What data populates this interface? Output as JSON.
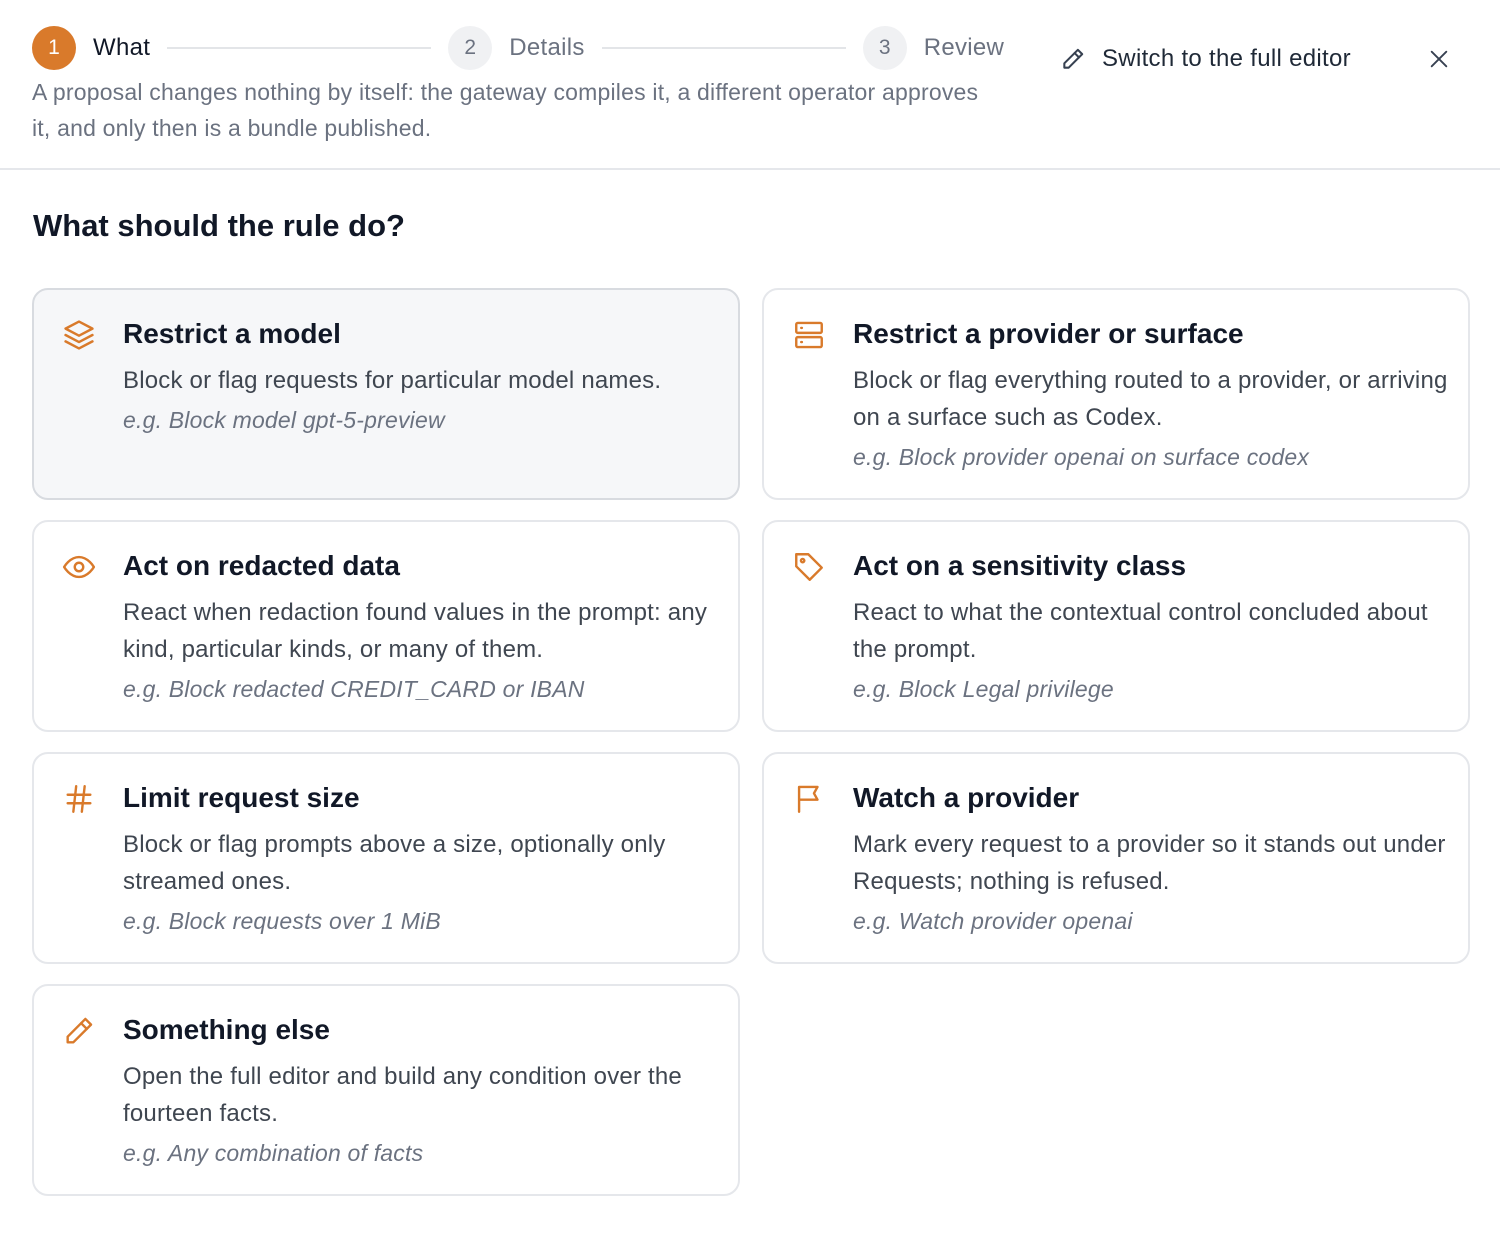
{
  "steps": [
    {
      "number": "1",
      "label": "What"
    },
    {
      "number": "2",
      "label": "Details"
    },
    {
      "number": "3",
      "label": "Review"
    }
  ],
  "header": {
    "switch_label": "Switch to the full editor",
    "subtitle": "A proposal changes nothing by itself: the gateway compiles it, a different operator approves it, and only then is a bundle published."
  },
  "question": "What should the rule do?",
  "accent_color": "#d97a2b",
  "options": [
    {
      "title": "Restrict a model",
      "description": "Block or flag requests for particular model names.",
      "example": "e.g. Block model gpt-5-preview",
      "icon": "layers-icon"
    },
    {
      "title": "Restrict a provider or surface",
      "description": "Block or flag everything routed to a provider, or arriving on a surface such as Codex.",
      "example": "e.g. Block provider openai on surface codex",
      "icon": "server-icon"
    },
    {
      "title": "Act on redacted data",
      "description": "React when redaction found values in the prompt: any kind, particular kinds, or many of them.",
      "example": "e.g. Block redacted CREDIT_CARD or IBAN",
      "icon": "eye-icon"
    },
    {
      "title": "Act on a sensitivity class",
      "description": "React to what the contextual control concluded about the prompt.",
      "example": "e.g. Block Legal privilege",
      "icon": "tag-icon"
    },
    {
      "title": "Limit request size",
      "description": "Block or flag prompts above a size, optionally only streamed ones.",
      "example": "e.g. Block requests over 1 MiB",
      "icon": "hash-icon"
    },
    {
      "title": "Watch a provider",
      "description": "Mark every request to a provider so it stands out under Requests; nothing is refused.",
      "example": "e.g. Watch provider openai",
      "icon": "flag-icon"
    },
    {
      "title": "Something else",
      "description": "Open the full editor and build any condition over the fourteen facts.",
      "example": "e.g. Any combination of facts",
      "icon": "pencil-icon"
    }
  ]
}
